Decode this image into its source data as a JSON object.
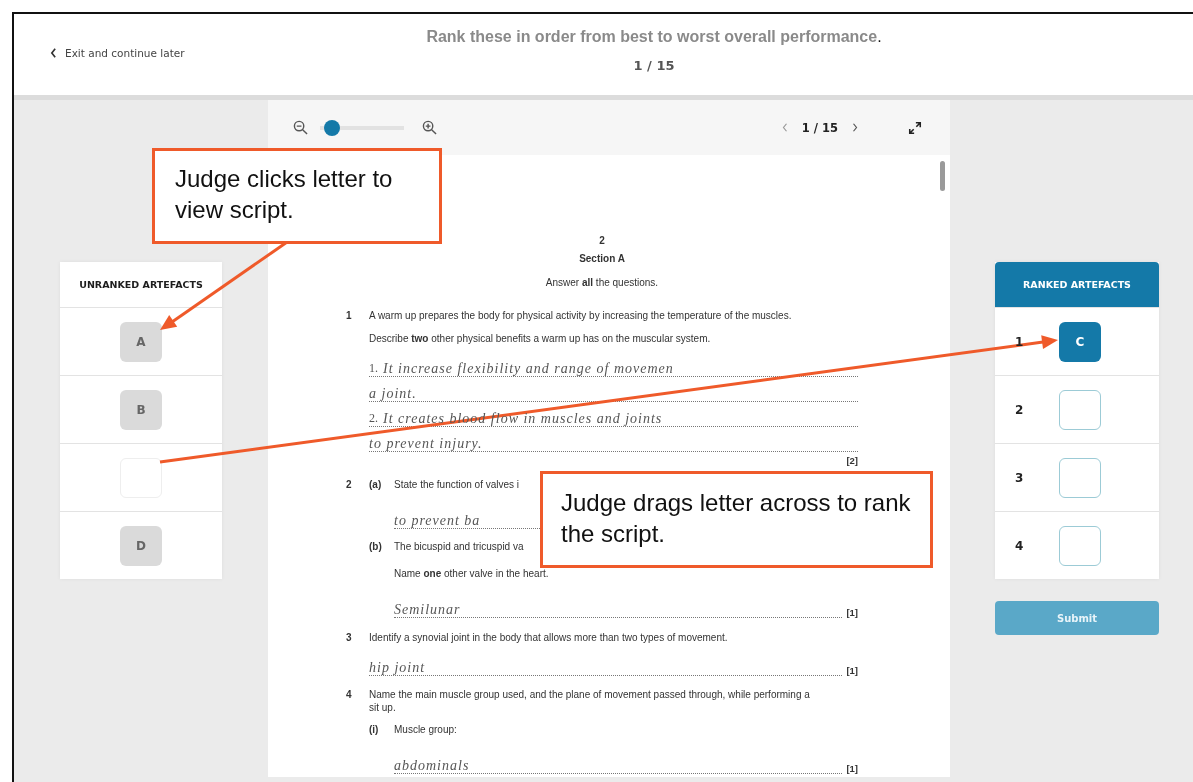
{
  "header": {
    "back_link": "Exit and continue later",
    "instruction": "**Rank these in order from best to worst overall performance**.",
    "counter": "1 / 15"
  },
  "viewer": {
    "zoom": {
      "level": 0.05
    },
    "page_nav": "1 / 15"
  },
  "document": {
    "page_number": "2",
    "section": "Section A",
    "intro": "Answer **all** the questions.",
    "questions": [
      {
        "number": "1",
        "text": "A warm up prepares the body for physical activity by increasing the temperature of the muscles.",
        "children": [
          {
            "kind": "text",
            "text": "Describe **two** other physical benefits a warm up has on the muscular system."
          },
          {
            "kind": "answer",
            "label": "1.",
            "text": "It increase flexibility and range of movemen"
          },
          {
            "kind": "answer",
            "text": "a joint."
          },
          {
            "kind": "answer",
            "label": "2.",
            "text": "It creates blood flow in muscles and joints"
          },
          {
            "kind": "answer",
            "text": "to prevent injury."
          },
          {
            "kind": "marks",
            "text": "[2]"
          }
        ]
      },
      {
        "number": "2",
        "children": [
          {
            "kind": "part",
            "label": "(a)",
            "text": "State the function of valves i",
            "children": [
              {
                "kind": "answer",
                "text": "to prevent ba"
              }
            ]
          },
          {
            "kind": "part",
            "label": "(b)",
            "text": "The bicuspid and tricuspid va",
            "children": [
              {
                "kind": "text",
                "text": "Name **one** other valve in the heart."
              },
              {
                "kind": "answer",
                "text": "Semilunar",
                "marks": "[1]"
              }
            ]
          }
        ]
      },
      {
        "number": "3",
        "text": "Identify a synovial joint in the body that allows more than two types of movement.",
        "children": [
          {
            "kind": "answer",
            "text": "hip joint",
            "marks": "[1]"
          }
        ]
      },
      {
        "number": "4",
        "text": "Name the main muscle group used, and the plane of movement passed through, while performing a sit up.",
        "children": [
          {
            "kind": "part",
            "label": "(i)",
            "text": "Muscle group:",
            "children": [
              {
                "kind": "answer",
                "text": "abdominals",
                "marks": "[1]"
              }
            ]
          }
        ]
      }
    ]
  },
  "unranked": {
    "title": "UNRANKED ARTEFACTS",
    "items": [
      {
        "filled": true,
        "letter": "A"
      },
      {
        "filled": true,
        "letter": "B"
      },
      {
        "filled": false
      },
      {
        "filled": true,
        "letter": "D"
      }
    ]
  },
  "ranked": {
    "title": "RANKED ARTEFACTS",
    "items": [
      {
        "rank": "1",
        "filled": true,
        "letter": "C"
      },
      {
        "rank": "2",
        "filled": false
      },
      {
        "rank": "3",
        "filled": false
      },
      {
        "rank": "4",
        "filled": false
      }
    ]
  },
  "submit": {
    "label": "Submit",
    "disabled": true
  },
  "callouts": [
    {
      "text": "Judge clicks letter to view script."
    },
    {
      "text": "Judge drags letter across to rank the script."
    }
  ]
}
